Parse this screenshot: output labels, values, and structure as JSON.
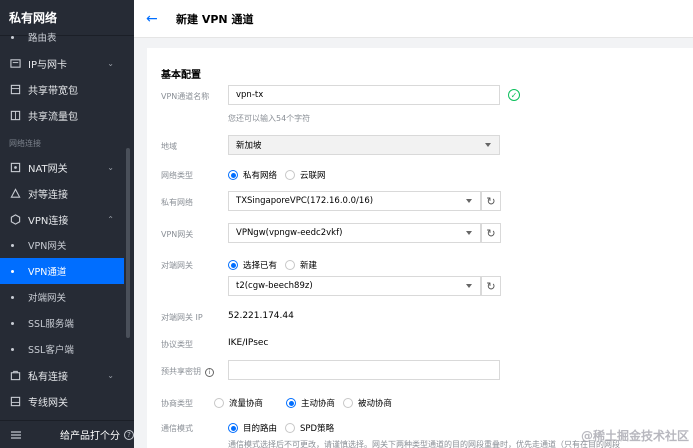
{
  "sidebar": {
    "title": "私有网络",
    "top_item": "路由表",
    "items_top": [
      {
        "label": "IP与网卡",
        "icon": "ip-card-icon",
        "chevron": true
      },
      {
        "label": "共享带宽包",
        "icon": "bandwidth-package-icon"
      },
      {
        "label": "共享流量包",
        "icon": "traffic-package-icon"
      }
    ],
    "section_label": "网络连接",
    "items_conn": [
      {
        "label": "NAT网关",
        "icon": "nat-gateway-icon",
        "chevron": true
      },
      {
        "label": "对等连接",
        "icon": "peering-icon"
      },
      {
        "label": "VPN连接",
        "icon": "vpn-icon",
        "chevron": true
      }
    ],
    "vpn_children": [
      {
        "label": "VPN网关",
        "active": false
      },
      {
        "label": "VPN通道",
        "active": true
      },
      {
        "label": "对端网关",
        "active": false
      },
      {
        "label": "SSL服务端",
        "active": false
      },
      {
        "label": "SSL客户端",
        "active": false
      }
    ],
    "items_bottom": [
      {
        "label": "私有连接",
        "icon": "private-link-icon",
        "chevron": true
      },
      {
        "label": "专线网关",
        "icon": "dc-gateway-icon"
      }
    ],
    "footer_label": "给产品打个分"
  },
  "header": {
    "title": "新建 VPN 通道"
  },
  "form": {
    "section_title": "基本配置",
    "name_label": "VPN通道名称",
    "name_value": "vpn-tx",
    "name_hint": "您还可以输入54个字符",
    "region_label": "地域",
    "region_value": "新加坡",
    "net_type_label": "网络类型",
    "net_type_options": [
      "私有网络",
      "云联网"
    ],
    "vpc_label": "私有网络",
    "vpc_value": "TXSingaporeVPC(172.16.0.0/16)",
    "vpn_gw_label": "VPN网关",
    "vpn_gw_value": "VPNgw(vpngw-eedc2vkf)",
    "peer_gw_label": "对端网关",
    "peer_gw_options": [
      "选择已有",
      "新建"
    ],
    "peer_gw_value": "t2(cgw-beech89z)",
    "peer_ip_label": "对端网关 IP",
    "peer_ip_value": "52.221.174.44",
    "protocol_label": "协议类型",
    "protocol_value": "IKE/IPsec",
    "psk_label": "预共享密钥",
    "negotiation_label": "协商类型",
    "negotiation_options": [
      "流量协商",
      "主动协商",
      "被动协商"
    ],
    "comm_mode_label": "通信模式",
    "comm_mode_options": [
      "目的路由",
      "SPD策略"
    ],
    "comm_mode_hint": "通信模式选择后不可更改，请谨慎选择。网关下两种类型通道的目的网段重叠时，优先走通道（只有在目的网段"
  },
  "watermark": "@稀土掘金技术社区",
  "colors": {
    "accent": "#006eff",
    "sidebar_bg": "#262b35",
    "success": "#0abf5b"
  }
}
